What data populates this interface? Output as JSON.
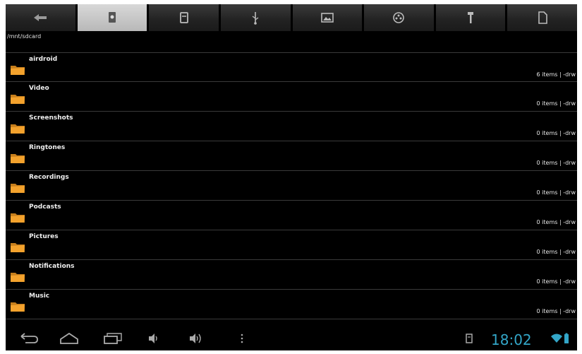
{
  "toolbar": {
    "tabs": [
      {
        "icon": "back-arrow-icon",
        "active": false
      },
      {
        "icon": "internal-storage-icon",
        "active": true
      },
      {
        "icon": "sdcard-icon",
        "active": false
      },
      {
        "icon": "usb-icon",
        "active": false
      },
      {
        "icon": "image-icon",
        "active": false
      },
      {
        "icon": "film-reel-icon",
        "active": false
      },
      {
        "icon": "tools-icon",
        "active": false
      },
      {
        "icon": "document-icon",
        "active": false
      }
    ]
  },
  "path": "/mnt/sdcard",
  "folders": [
    {
      "name": "airdroid",
      "info": "6 items | -drw"
    },
    {
      "name": "Video",
      "info": "0 items | -drw"
    },
    {
      "name": "Screenshots",
      "info": "0 items | -drw"
    },
    {
      "name": "Ringtones",
      "info": "0 items | -drw"
    },
    {
      "name": "Recordings",
      "info": "0 items | -drw"
    },
    {
      "name": "Podcasts",
      "info": "0 items | -drw"
    },
    {
      "name": "Pictures",
      "info": "0 items | -drw"
    },
    {
      "name": "Notifications",
      "info": "0 items | -drw"
    },
    {
      "name": "Music",
      "info": "0 items | -drw"
    }
  ],
  "statusbar": {
    "time": "18:02"
  },
  "colors": {
    "folder": "#f3a22d",
    "clock": "#33a6c8",
    "background": "#000000"
  }
}
